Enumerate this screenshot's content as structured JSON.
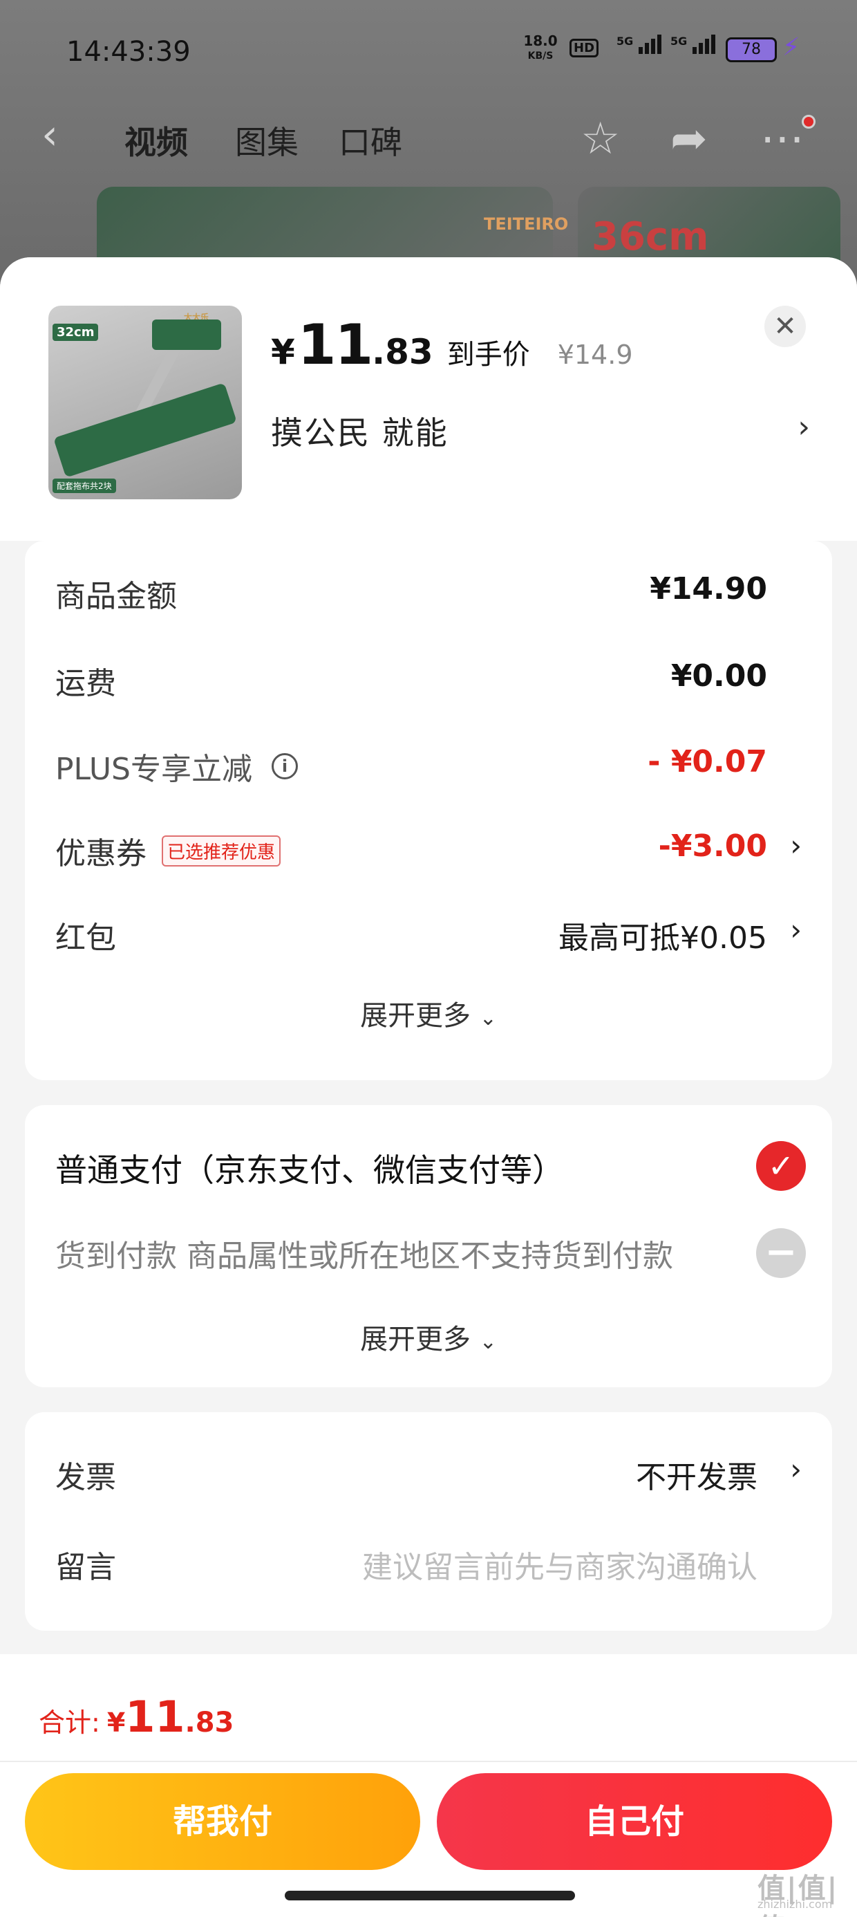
{
  "status_bar": {
    "time": "14:43:39",
    "speed_value": "18.0",
    "speed_unit": "KB/S",
    "hd": "HD",
    "net1": "5G",
    "net2": "5G",
    "battery": "78"
  },
  "nav": {
    "tabs": [
      "视频",
      "图集",
      "口碑"
    ]
  },
  "background": {
    "thumb_size": "36cm",
    "thumb_brand": "TEITEIRO"
  },
  "product": {
    "image_tag": "32cm",
    "image_brand": "太太乐",
    "image_badge": "配套拖布共2块",
    "price_symbol": "¥",
    "price_int": "11",
    "price_dec": ".83",
    "price_tag": "到手价",
    "original_price": "¥14.9",
    "spec": "摸公民 就能"
  },
  "summary": {
    "rows": [
      {
        "label": "商品金额",
        "value": "¥14.90"
      },
      {
        "label": "运费",
        "value": "¥0.00"
      },
      {
        "label": "PLUS专享立减",
        "value": "- ¥0.07"
      },
      {
        "label": "优惠券",
        "tag": "已选推荐优惠",
        "value": "-¥3.00"
      },
      {
        "label": "红包",
        "value": "最高可抵¥0.05"
      }
    ],
    "expand": "展开更多"
  },
  "payment": {
    "options": [
      {
        "label": "普通支付（京东支付、微信支付等）"
      },
      {
        "label": "货到付款 商品属性或所在地区不支持货到付款"
      }
    ],
    "expand": "展开更多"
  },
  "extra": {
    "invoice_label": "发票",
    "invoice_value": "不开发票",
    "message_label": "留言",
    "message_placeholder": "建议留言前先与商家沟通确认"
  },
  "footer": {
    "total_label": "合计:",
    "total_symbol": "¥",
    "total_int": "11",
    "total_dec": ".83",
    "help_pay": "帮我付",
    "self_pay": "自己付"
  },
  "watermark": {
    "text": "值|值|值",
    "sub": "zhizhizhi.com"
  },
  "colors": {
    "accent_red": "#e2231a",
    "help_yellow": "#ffb20f",
    "self_red": "#f5364a"
  }
}
